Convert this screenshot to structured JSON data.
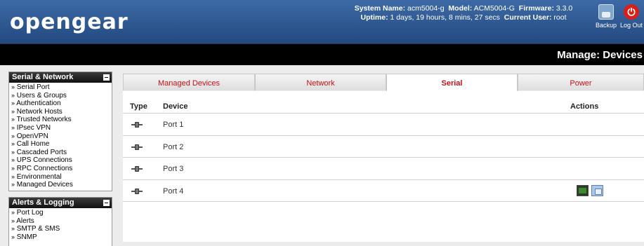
{
  "header": {
    "logo": "opengear",
    "system_line1_label_name": "System Name:",
    "system_name": "acm5004-g",
    "system_line1_label_model": "Model:",
    "model": "ACM5004-G",
    "system_line1_label_firmware": "Firmware:",
    "firmware": "3.3.0",
    "system_line2_label_uptime": "Uptime:",
    "uptime": "1 days, 19 hours, 8 mins, 27 secs",
    "system_line2_label_user": "Current User:",
    "current_user": "root",
    "backup_label": "Backup",
    "logout_label": "Log Out",
    "logout_glyph": "⏻"
  },
  "title": "Manage: Devices",
  "sidebar": {
    "serial_network": {
      "title": "Serial & Network",
      "items": [
        "Serial Port",
        "Users & Groups",
        "Authentication",
        "Network Hosts",
        "Trusted Networks",
        "IPsec VPN",
        "OpenVPN",
        "Call Home",
        "Cascaded Ports",
        "UPS Connections",
        "RPC Connections",
        "Environmental",
        "Managed Devices"
      ]
    },
    "alerts_logging": {
      "title": "Alerts & Logging",
      "items": [
        "Port Log",
        "Alerts",
        "SMTP & SMS",
        "SNMP"
      ]
    },
    "bullet": "»"
  },
  "tabs": [
    {
      "label": "Managed Devices",
      "active": false
    },
    {
      "label": "Network",
      "active": false
    },
    {
      "label": "Serial",
      "active": true
    },
    {
      "label": "Power",
      "active": false
    }
  ],
  "table": {
    "headers": {
      "type": "Type",
      "device": "Device",
      "actions": "Actions"
    },
    "rows": [
      {
        "device": "Port 1"
      },
      {
        "device": "Port 2"
      },
      {
        "device": "Port 3"
      },
      {
        "device": "Port 4"
      }
    ]
  },
  "colors": {
    "header_blue": "#2f5a92",
    "tab_text_red": "#c0121a",
    "title_bar": "#000000"
  }
}
